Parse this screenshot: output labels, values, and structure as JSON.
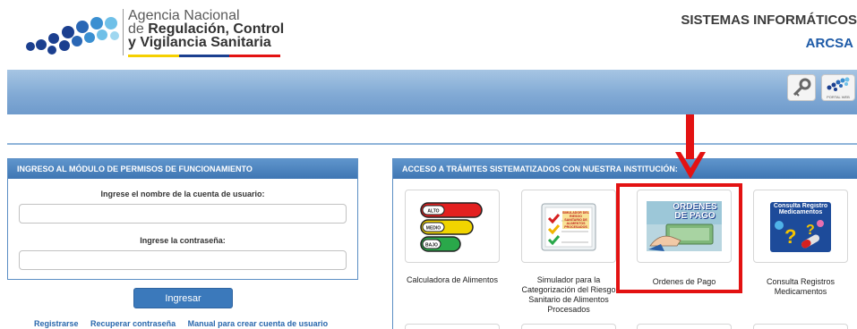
{
  "header": {
    "agency_line1": "Agencia Nacional",
    "agency_line2_prefix": "de ",
    "agency_line2_bold": "Regulación, Control",
    "agency_line3": "y Vigilancia Sanitaria",
    "system_title": "SISTEMAS INFORMÁTICOS",
    "system_subtitle": "ARCSA",
    "portal_label": "PORTAL WEB"
  },
  "login_panel": {
    "title": "INGRESO AL MÓDULO DE PERMISOS DE FUNCIONAMIENTO",
    "username_label": "Ingrese el nombre de la cuenta de usuario:",
    "username_value": "",
    "password_label": "Ingrese la contraseña:",
    "password_value": "",
    "submit_label": "Ingresar",
    "links": [
      "Registrarse",
      "Recuperar contraseña",
      "Manual para crear cuenta de usuario"
    ]
  },
  "services_panel": {
    "title": "ACCESO A TRÁMITES SISTEMATIZADOS CON NUESTRA INSTITUCIÓN:",
    "tiles": [
      {
        "label": "Calculadora de Alimentos",
        "image_text": [
          "ALTO",
          "MEDIO",
          "BAJO"
        ]
      },
      {
        "label": "Simulador para la Categorización del Riesgo Sanitario de Alimentos Procesados",
        "image_text": [
          "SIMULADOR DEL RIESGO SANITARIO DE ALIMENTOS PROCESADOS"
        ]
      },
      {
        "label": "Ordenes de Pago",
        "image_text": [
          "ORDENES DE PAGO"
        ]
      },
      {
        "label": "Consulta Registros Medicamentos",
        "image_text": [
          "Consulta Registro Medicamentos"
        ]
      }
    ]
  },
  "colors": {
    "band": "#82aad5",
    "panel_header": "#4a80bc",
    "button": "#3b79bb",
    "link": "#2a68ad",
    "highlight": "#e31212"
  }
}
